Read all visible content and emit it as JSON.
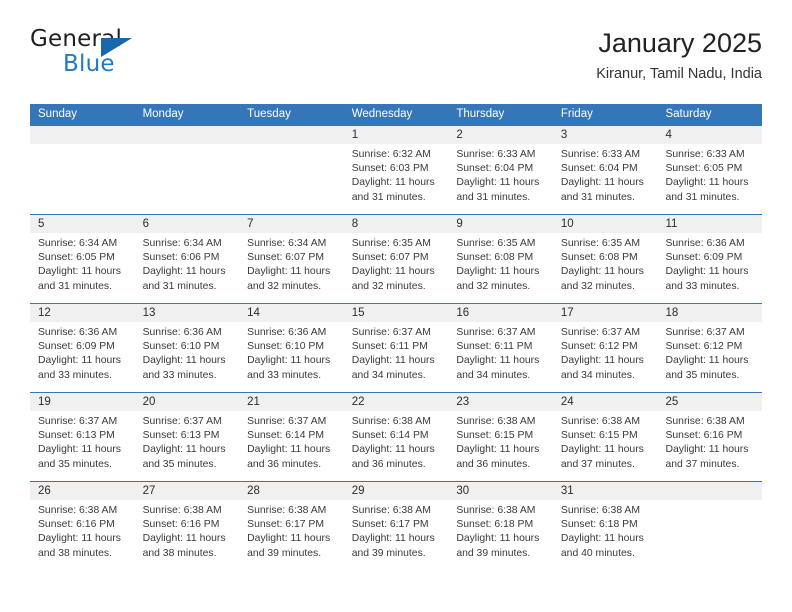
{
  "brand": {
    "word_general": "General",
    "word_blue": "Blue",
    "accent_color": "#1866ab"
  },
  "header": {
    "title": "January 2025",
    "location": "Kiranur, Tamil Nadu, India"
  },
  "theme": {
    "header_blue": "#3576b8",
    "day_band_gray": "#f0f0f0"
  },
  "weekdays": [
    "Sunday",
    "Monday",
    "Tuesday",
    "Wednesday",
    "Thursday",
    "Friday",
    "Saturday"
  ],
  "weeks": [
    [
      {
        "day": "",
        "sunrise": "",
        "sunset": "",
        "daylight_line1": "",
        "daylight_line2": ""
      },
      {
        "day": "",
        "sunrise": "",
        "sunset": "",
        "daylight_line1": "",
        "daylight_line2": ""
      },
      {
        "day": "",
        "sunrise": "",
        "sunset": "",
        "daylight_line1": "",
        "daylight_line2": ""
      },
      {
        "day": "1",
        "sunrise": "Sunrise: 6:32 AM",
        "sunset": "Sunset: 6:03 PM",
        "daylight_line1": "Daylight: 11 hours",
        "daylight_line2": "and 31 minutes."
      },
      {
        "day": "2",
        "sunrise": "Sunrise: 6:33 AM",
        "sunset": "Sunset: 6:04 PM",
        "daylight_line1": "Daylight: 11 hours",
        "daylight_line2": "and 31 minutes."
      },
      {
        "day": "3",
        "sunrise": "Sunrise: 6:33 AM",
        "sunset": "Sunset: 6:04 PM",
        "daylight_line1": "Daylight: 11 hours",
        "daylight_line2": "and 31 minutes."
      },
      {
        "day": "4",
        "sunrise": "Sunrise: 6:33 AM",
        "sunset": "Sunset: 6:05 PM",
        "daylight_line1": "Daylight: 11 hours",
        "daylight_line2": "and 31 minutes."
      }
    ],
    [
      {
        "day": "5",
        "sunrise": "Sunrise: 6:34 AM",
        "sunset": "Sunset: 6:05 PM",
        "daylight_line1": "Daylight: 11 hours",
        "daylight_line2": "and 31 minutes."
      },
      {
        "day": "6",
        "sunrise": "Sunrise: 6:34 AM",
        "sunset": "Sunset: 6:06 PM",
        "daylight_line1": "Daylight: 11 hours",
        "daylight_line2": "and 31 minutes."
      },
      {
        "day": "7",
        "sunrise": "Sunrise: 6:34 AM",
        "sunset": "Sunset: 6:07 PM",
        "daylight_line1": "Daylight: 11 hours",
        "daylight_line2": "and 32 minutes."
      },
      {
        "day": "8",
        "sunrise": "Sunrise: 6:35 AM",
        "sunset": "Sunset: 6:07 PM",
        "daylight_line1": "Daylight: 11 hours",
        "daylight_line2": "and 32 minutes."
      },
      {
        "day": "9",
        "sunrise": "Sunrise: 6:35 AM",
        "sunset": "Sunset: 6:08 PM",
        "daylight_line1": "Daylight: 11 hours",
        "daylight_line2": "and 32 minutes."
      },
      {
        "day": "10",
        "sunrise": "Sunrise: 6:35 AM",
        "sunset": "Sunset: 6:08 PM",
        "daylight_line1": "Daylight: 11 hours",
        "daylight_line2": "and 32 minutes."
      },
      {
        "day": "11",
        "sunrise": "Sunrise: 6:36 AM",
        "sunset": "Sunset: 6:09 PM",
        "daylight_line1": "Daylight: 11 hours",
        "daylight_line2": "and 33 minutes."
      }
    ],
    [
      {
        "day": "12",
        "sunrise": "Sunrise: 6:36 AM",
        "sunset": "Sunset: 6:09 PM",
        "daylight_line1": "Daylight: 11 hours",
        "daylight_line2": "and 33 minutes."
      },
      {
        "day": "13",
        "sunrise": "Sunrise: 6:36 AM",
        "sunset": "Sunset: 6:10 PM",
        "daylight_line1": "Daylight: 11 hours",
        "daylight_line2": "and 33 minutes."
      },
      {
        "day": "14",
        "sunrise": "Sunrise: 6:36 AM",
        "sunset": "Sunset: 6:10 PM",
        "daylight_line1": "Daylight: 11 hours",
        "daylight_line2": "and 33 minutes."
      },
      {
        "day": "15",
        "sunrise": "Sunrise: 6:37 AM",
        "sunset": "Sunset: 6:11 PM",
        "daylight_line1": "Daylight: 11 hours",
        "daylight_line2": "and 34 minutes."
      },
      {
        "day": "16",
        "sunrise": "Sunrise: 6:37 AM",
        "sunset": "Sunset: 6:11 PM",
        "daylight_line1": "Daylight: 11 hours",
        "daylight_line2": "and 34 minutes."
      },
      {
        "day": "17",
        "sunrise": "Sunrise: 6:37 AM",
        "sunset": "Sunset: 6:12 PM",
        "daylight_line1": "Daylight: 11 hours",
        "daylight_line2": "and 34 minutes."
      },
      {
        "day": "18",
        "sunrise": "Sunrise: 6:37 AM",
        "sunset": "Sunset: 6:12 PM",
        "daylight_line1": "Daylight: 11 hours",
        "daylight_line2": "and 35 minutes."
      }
    ],
    [
      {
        "day": "19",
        "sunrise": "Sunrise: 6:37 AM",
        "sunset": "Sunset: 6:13 PM",
        "daylight_line1": "Daylight: 11 hours",
        "daylight_line2": "and 35 minutes."
      },
      {
        "day": "20",
        "sunrise": "Sunrise: 6:37 AM",
        "sunset": "Sunset: 6:13 PM",
        "daylight_line1": "Daylight: 11 hours",
        "daylight_line2": "and 35 minutes."
      },
      {
        "day": "21",
        "sunrise": "Sunrise: 6:37 AM",
        "sunset": "Sunset: 6:14 PM",
        "daylight_line1": "Daylight: 11 hours",
        "daylight_line2": "and 36 minutes."
      },
      {
        "day": "22",
        "sunrise": "Sunrise: 6:38 AM",
        "sunset": "Sunset: 6:14 PM",
        "daylight_line1": "Daylight: 11 hours",
        "daylight_line2": "and 36 minutes."
      },
      {
        "day": "23",
        "sunrise": "Sunrise: 6:38 AM",
        "sunset": "Sunset: 6:15 PM",
        "daylight_line1": "Daylight: 11 hours",
        "daylight_line2": "and 36 minutes."
      },
      {
        "day": "24",
        "sunrise": "Sunrise: 6:38 AM",
        "sunset": "Sunset: 6:15 PM",
        "daylight_line1": "Daylight: 11 hours",
        "daylight_line2": "and 37 minutes."
      },
      {
        "day": "25",
        "sunrise": "Sunrise: 6:38 AM",
        "sunset": "Sunset: 6:16 PM",
        "daylight_line1": "Daylight: 11 hours",
        "daylight_line2": "and 37 minutes."
      }
    ],
    [
      {
        "day": "26",
        "sunrise": "Sunrise: 6:38 AM",
        "sunset": "Sunset: 6:16 PM",
        "daylight_line1": "Daylight: 11 hours",
        "daylight_line2": "and 38 minutes."
      },
      {
        "day": "27",
        "sunrise": "Sunrise: 6:38 AM",
        "sunset": "Sunset: 6:16 PM",
        "daylight_line1": "Daylight: 11 hours",
        "daylight_line2": "and 38 minutes."
      },
      {
        "day": "28",
        "sunrise": "Sunrise: 6:38 AM",
        "sunset": "Sunset: 6:17 PM",
        "daylight_line1": "Daylight: 11 hours",
        "daylight_line2": "and 39 minutes."
      },
      {
        "day": "29",
        "sunrise": "Sunrise: 6:38 AM",
        "sunset": "Sunset: 6:17 PM",
        "daylight_line1": "Daylight: 11 hours",
        "daylight_line2": "and 39 minutes."
      },
      {
        "day": "30",
        "sunrise": "Sunrise: 6:38 AM",
        "sunset": "Sunset: 6:18 PM",
        "daylight_line1": "Daylight: 11 hours",
        "daylight_line2": "and 39 minutes."
      },
      {
        "day": "31",
        "sunrise": "Sunrise: 6:38 AM",
        "sunset": "Sunset: 6:18 PM",
        "daylight_line1": "Daylight: 11 hours",
        "daylight_line2": "and 40 minutes."
      },
      {
        "day": "",
        "sunrise": "",
        "sunset": "",
        "daylight_line1": "",
        "daylight_line2": ""
      }
    ]
  ]
}
